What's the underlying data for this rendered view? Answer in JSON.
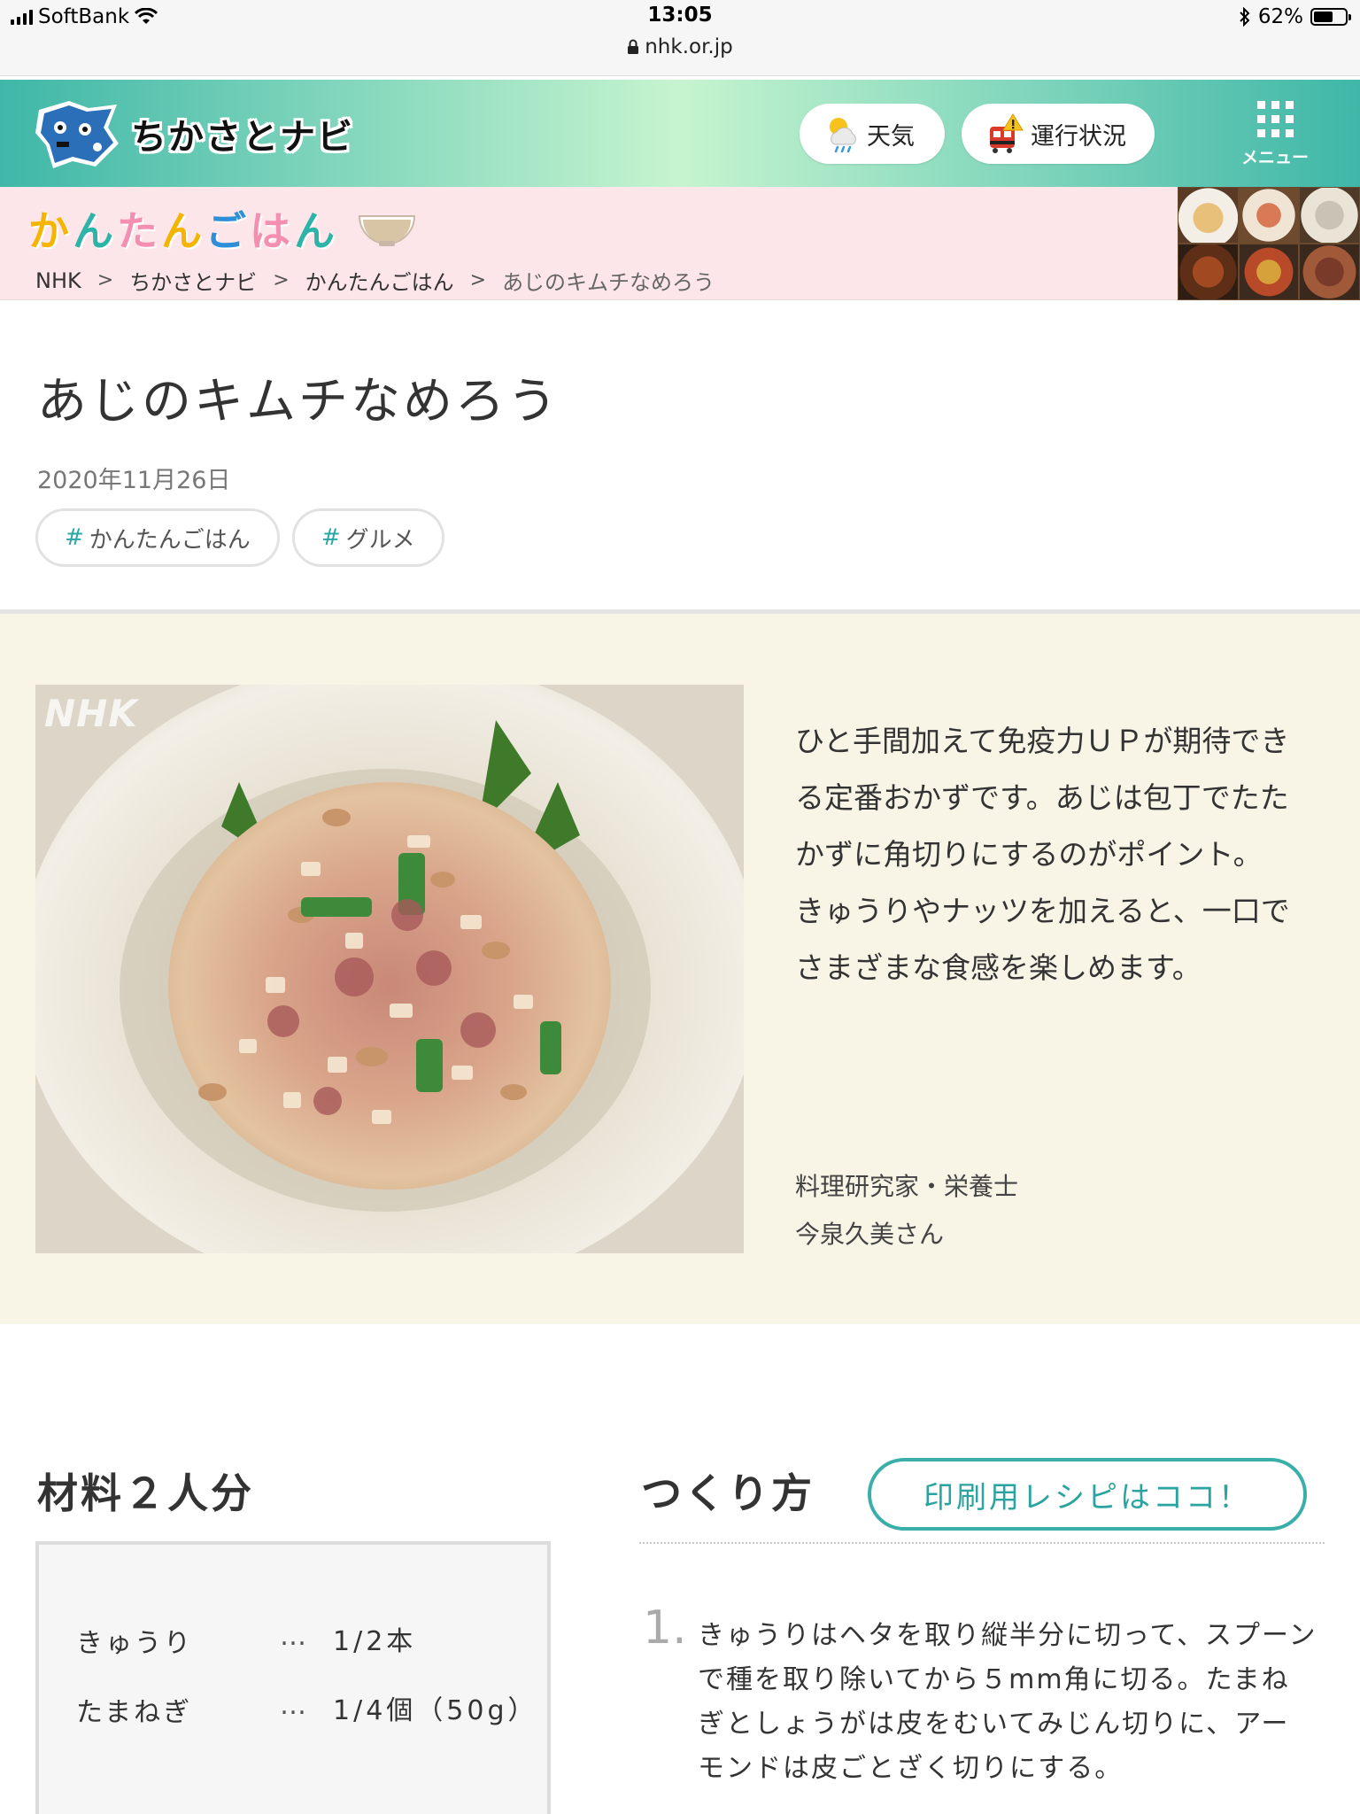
{
  "status_bar": {
    "carrier": "SoftBank",
    "time": "13:05",
    "url": "nhk.or.jp",
    "battery": "62%",
    "battery_level": 0.62
  },
  "header": {
    "logo_text": "ちかさとナビ",
    "weather_label": "天気",
    "train_label": "運行状況",
    "menu_label": "メニュー",
    "colors": {
      "gradient_edge": "#3fb7a8",
      "gradient_center": "#c6f4cf"
    }
  },
  "banner": {
    "title_chars": [
      "か",
      "ん",
      "た",
      "ん",
      "ご",
      "は",
      "ん"
    ],
    "title_colors": [
      "#f4b400",
      "#2db3a8",
      "#f48fb1",
      "#f4b400",
      "#2d8fd8",
      "#f48fb1",
      "#2db3a8"
    ],
    "breadcrumb": [
      "NHK",
      "ちかさとナビ",
      "かんたんごはん",
      "あじのキムチなめろう"
    ],
    "breadcrumb_sep": ">"
  },
  "article": {
    "title": "あじのキムチなめろう",
    "date": "2020年11月26日",
    "tags": [
      {
        "hash": "#",
        "label": "かんたんごはん"
      },
      {
        "hash": "#",
        "label": "グルメ"
      }
    ]
  },
  "intro": {
    "watermark": "NHK",
    "description": "ひと手間加えて免疫力ＵＰが期待できる定番おかずです。あじは包丁でたたかずに角切りにするのがポイント。きゅうりやナッツを加えると、一口でさまざまな食感を楽しめます。",
    "credit_role": "料理研究家・栄養士",
    "credit_name": "今泉久美さん",
    "background": "#f8f4e6"
  },
  "ingredients": {
    "heading": "材料２人分",
    "items": [
      {
        "name": "きゅうり",
        "dots": "…",
        "amount": "1/2本"
      },
      {
        "name": "たまねぎ",
        "dots": "…",
        "amount": "1/4個（50g）"
      }
    ]
  },
  "steps": {
    "heading": "つくり方",
    "print_button": "印刷用レシピはココ！",
    "items": [
      {
        "num": "1.",
        "text": "きゅうりはヘタを取り縦半分に切って、スプーンで種を取り除いてから５mm角に切る。たまねぎとしょうがは皮をむいてみじん切りに、アーモンドは皮ごとざく切りにする。"
      }
    ]
  }
}
